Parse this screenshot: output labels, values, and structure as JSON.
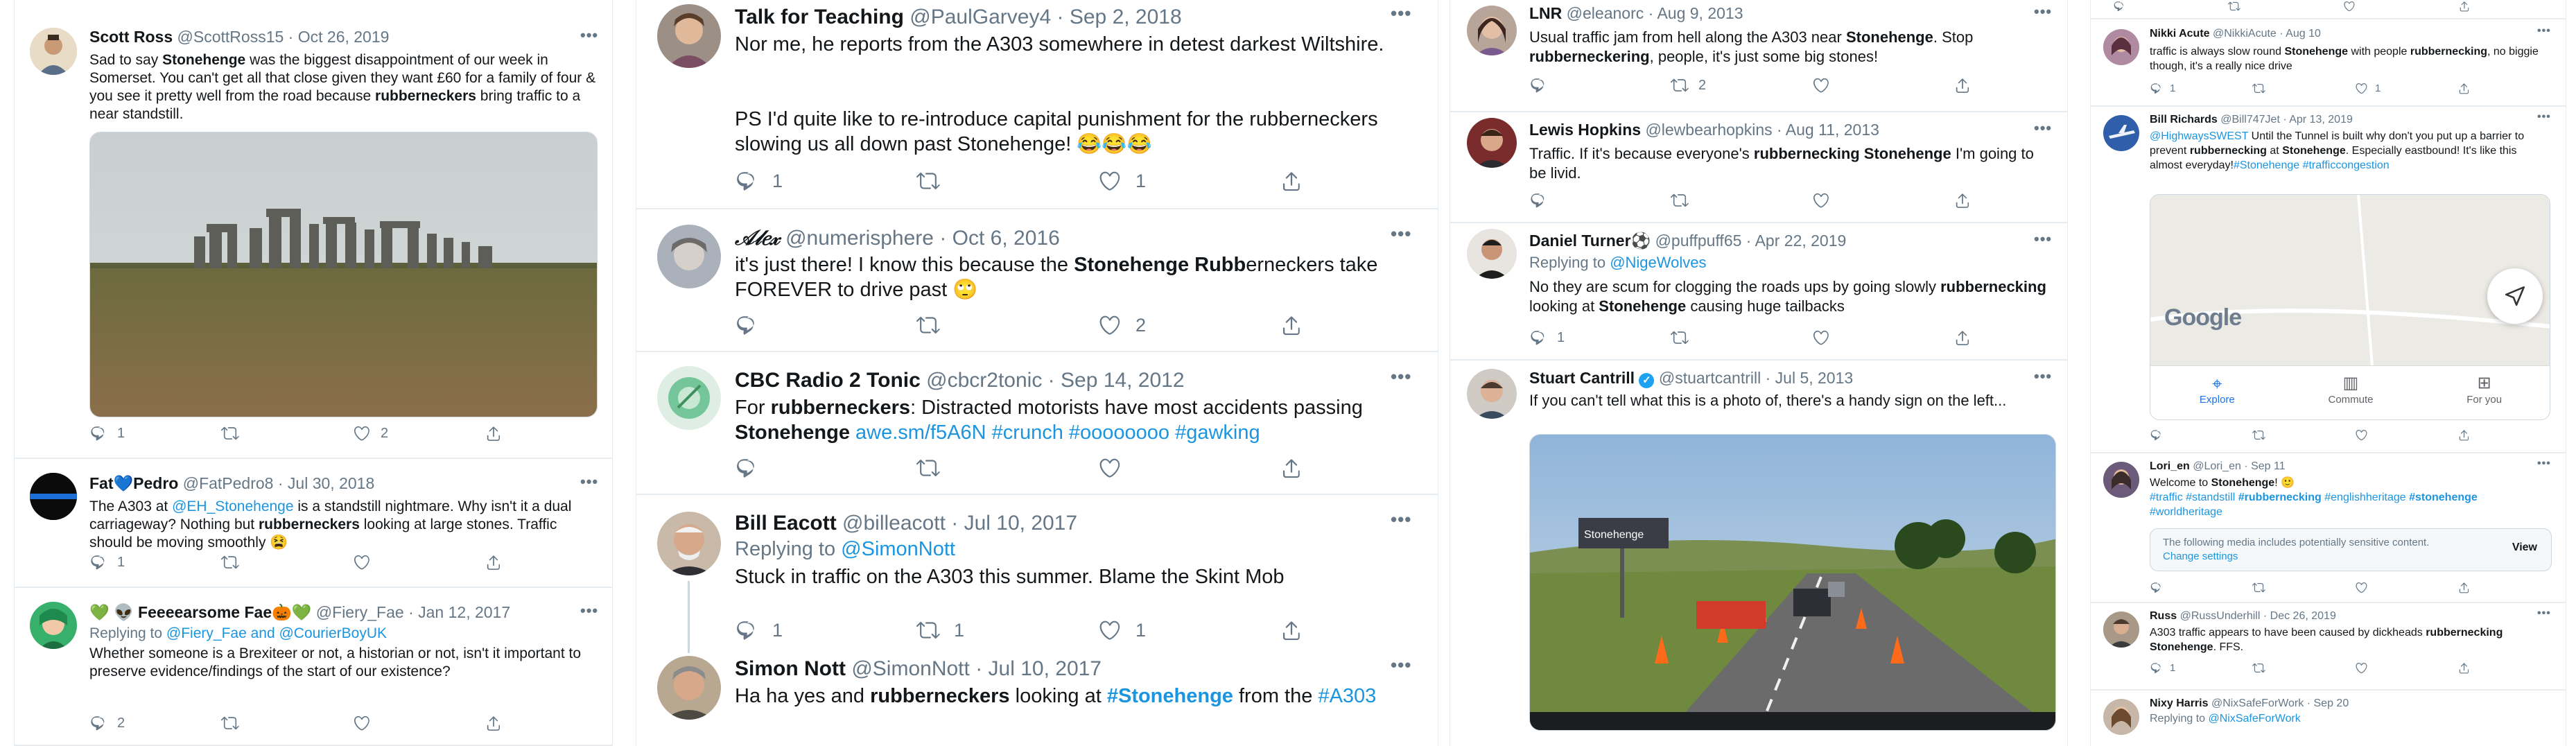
{
  "columns": {
    "c1": {
      "tweets": [
        {
          "name": "Scott Ross",
          "handle": "@ScottRoss15",
          "date": "Oct 26, 2019",
          "text": [
            "Sad to say ",
            "Stonehenge",
            " was the biggest disappointment of our week in Somerset. You can't get all that close given they want £60 for a family of four & you see it pretty well from the road because ",
            "rubberneckers",
            " bring traffic to a near standstill."
          ],
          "replies": "1",
          "retweets": "",
          "likes": "2"
        },
        {
          "name": "Fat💙Pedro",
          "handle": "@FatPedro8",
          "date": "Jul 30, 2018",
          "text": [
            "The A303 at ",
            "@EH_Stonehenge",
            " is a standstill nightmare. Why isn't it a dual carriageway? Nothing but ",
            "rubberneckers",
            " looking at large stones. Traffic should be moving smoothly 😫"
          ],
          "replies": "1",
          "retweets": "",
          "likes": ""
        },
        {
          "name": "💚 👽 Feeeearsome Fae🎃💚",
          "handle": "@Fiery_Fae",
          "date": "Jan 12, 2017",
          "replying_prefix": "Replying to ",
          "replying_to": "@Fiery_Fae and @CourierBoyUK",
          "text": [
            "Whether someone is a Brexiteer or not, a historian or not, isn't it important to preserve evidence/findings of the start of our existence?"
          ],
          "replies": "2",
          "retweets": "",
          "likes": ""
        }
      ]
    },
    "c2": {
      "tweets": [
        {
          "name": "Talk for Teaching",
          "handle": "@PaulGarvey4",
          "date": "Sep 2, 2018",
          "text": [
            "Nor me, he reports from the A303 somewhere in detest darkest Wiltshire."
          ],
          "text2": [
            "PS I'd quite like to re-introduce capital punishment for the rubberneckers slowing us all down past Stonehenge! 😂😂😂"
          ],
          "replies": "1",
          "retweets": "",
          "likes": "1"
        },
        {
          "name": "𝒜𝓁𝑒𝓍",
          "handle": "@numerisphere",
          "date": "Oct 6, 2016",
          "text": [
            "it's just there! I know this because the ",
            "Stonehenge Rubb",
            "erneckers take FOREVER to drive past 🙄"
          ],
          "replies": "",
          "retweets": "",
          "likes": "2"
        },
        {
          "name": "CBC Radio 2 Tonic",
          "handle": "@cbcr2tonic",
          "date": "Sep 14, 2012",
          "text": [
            "For ",
            "rubberneckers",
            ": Distracted motorists have most accidents passing ",
            "Stonehenge",
            " ",
            "awe.sm/f5A6N #crunch #oooooooo #gawking"
          ],
          "replies": "",
          "retweets": "",
          "likes": ""
        },
        {
          "name": "Bill Eacott",
          "handle": "@billeacott",
          "date": "Jul 10, 2017",
          "replying_prefix": "Replying to ",
          "replying_to": "@SimonNott",
          "text": [
            "Stuck in traffic on the A303 this summer. Blame the Skint Mob"
          ],
          "replies": "1",
          "retweets": "1",
          "likes": "1"
        },
        {
          "name": "Simon Nott",
          "handle": "@SimonNott",
          "date": "Jul 10, 2017",
          "text": [
            "Ha ha yes and ",
            "rubberneckers",
            " looking at ",
            "#Stonehenge",
            " from the ",
            "#A303"
          ],
          "replies": "",
          "retweets": "",
          "likes": ""
        }
      ]
    },
    "c3": {
      "tweets": [
        {
          "name": "LNR",
          "handle": "@eleanorc",
          "date": "Aug 9, 2013",
          "text": [
            "Usual traffic jam from hell along the A303 near ",
            "Stonehenge",
            ". Stop ",
            "rubberneckering",
            ", people, it's just some big stones!"
          ],
          "replies": "",
          "retweets": "2",
          "likes": ""
        },
        {
          "name": "Lewis Hopkins",
          "handle": "@lewbearhopkins",
          "date": "Aug 11, 2013",
          "text": [
            "Traffic. If it's because everyone's ",
            "rubbernecking Stonehenge",
            " I'm going to be livid."
          ],
          "replies": "",
          "retweets": "",
          "likes": ""
        },
        {
          "name": "Daniel Turner⚽",
          "handle": "@puffpuff65",
          "date": "Apr 22, 2019",
          "replying_prefix": "Replying to ",
          "replying_to": "@NigeWolves",
          "text": [
            "No they are scum for clogging the roads ups by going slowly ",
            "rubbernecking",
            " looking at ",
            "Stonehenge",
            " causing huge tailbacks"
          ],
          "replies": "1",
          "retweets": "",
          "likes": ""
        },
        {
          "name": "Stuart Cantrill",
          "handle": "@stuartcantrill",
          "date": "Jul 5, 2013",
          "text": [
            "If you can't tell what this is a photo of, there's a handy sign on the left..."
          ],
          "replies": "",
          "retweets": "",
          "likes": ""
        }
      ]
    },
    "c4": {
      "tweets": [
        {
          "name": "Nikki Acute",
          "handle": "@NikkiAcute",
          "date": "Aug 10",
          "text": [
            "traffic is always slow round ",
            "Stonehenge",
            " with people ",
            "rubbernecking",
            ", no biggie though, it's a really nice drive"
          ],
          "replies": "1",
          "retweets": "",
          "likes": "1"
        },
        {
          "name": "Bill Richards",
          "handle": "@Bill747Jet",
          "date": "Apr 13, 2019",
          "text": [
            "@HighwaysSWEST",
            " Until the Tunnel is built why don't you put up a barrier to prevent ",
            "rubbernecking",
            " at ",
            "Stonehenge",
            ". Especially eastbound! It's like this almost everyday!",
            "#Stonehenge #trafficcongestion"
          ],
          "replies": "",
          "retweets": "",
          "likes": "",
          "map": {
            "brand": "Google",
            "tabs": [
              "Explore",
              "Commute",
              "For you"
            ]
          }
        },
        {
          "name": "Lori_en",
          "handle": "@Lori_en",
          "date": "Sep 11",
          "text": [
            "Welcome to ",
            "Stonehenge",
            "! 🙂"
          ],
          "text2": [
            "#traffic #standstill ",
            "#rubbernecking",
            " #englishheritage ",
            "#stonehenge",
            " #worldheritage"
          ],
          "sensitive": "The following media includes potentially sensitive content.",
          "sensitive_link": "Change settings",
          "sensitive_btn": "View",
          "replies": "",
          "retweets": "",
          "likes": ""
        },
        {
          "name": "Russ",
          "handle": "@RussUnderhill",
          "date": "Dec 26, 2019",
          "text": [
            "A303 traffic appears to have been caused by dickheads ",
            "rubbernecking Stonehenge",
            ". FFS."
          ],
          "replies": "1",
          "retweets": "",
          "likes": ""
        },
        {
          "name": "Nixy Harris",
          "handle": "@NixSafeForWork",
          "date": "Sep 20",
          "replying_prefix": "Replying to ",
          "replying_to": "@NixSafeForWork",
          "replies": "",
          "retweets": "",
          "likes": ""
        }
      ]
    }
  },
  "sign_text": "Stonehenge"
}
